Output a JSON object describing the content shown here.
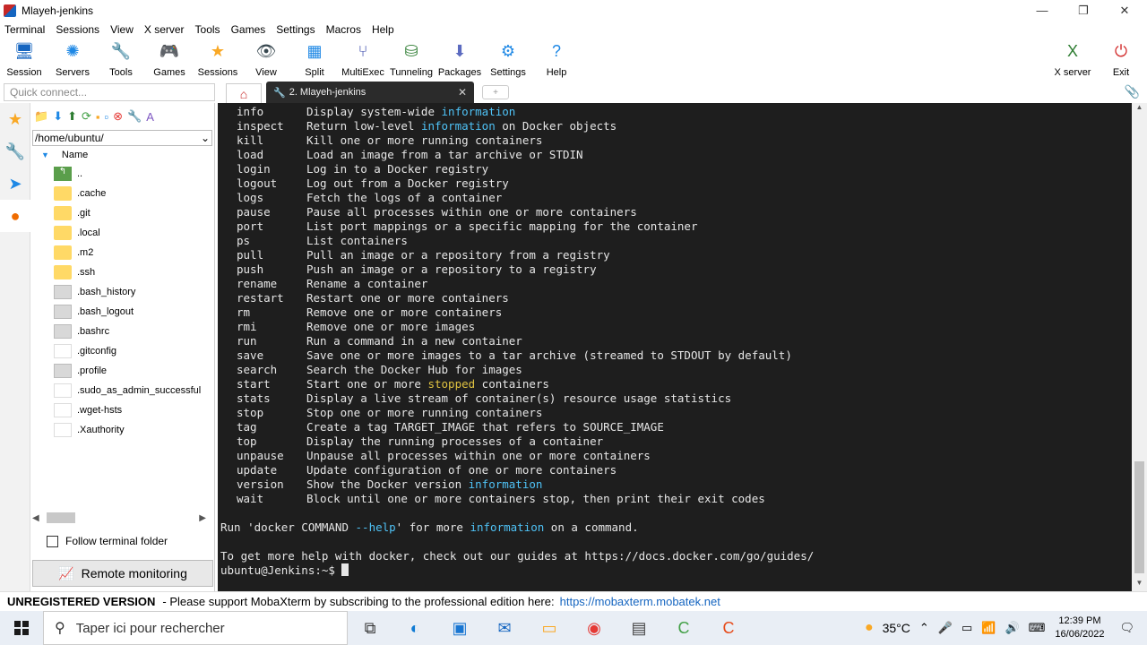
{
  "window": {
    "title": "Mlayeh-jenkins",
    "controls": {
      "minimize": "—",
      "maximize": "❐",
      "close": "✕"
    }
  },
  "menu": [
    "Terminal",
    "Sessions",
    "View",
    "X server",
    "Tools",
    "Games",
    "Settings",
    "Macros",
    "Help"
  ],
  "toolbar": [
    {
      "label": "Session",
      "icon": "🖥",
      "color": "#1565c0"
    },
    {
      "label": "Servers",
      "icon": "✺",
      "color": "#1e88e5"
    },
    {
      "label": "Tools",
      "icon": "🔧",
      "color": "#c62828"
    },
    {
      "label": "Games",
      "icon": "🎮",
      "color": "#555555"
    },
    {
      "label": "Sessions",
      "icon": "★",
      "color": "#f9a825"
    },
    {
      "label": "View",
      "icon": "👁",
      "color": "#37474f"
    },
    {
      "label": "Split",
      "icon": "▦",
      "color": "#1e88e5"
    },
    {
      "label": "MultiExec",
      "icon": "⑂",
      "color": "#3949ab"
    },
    {
      "label": "Tunneling",
      "icon": "⛁",
      "color": "#2e7d32"
    },
    {
      "label": "Packages",
      "icon": "⬇",
      "color": "#5c6bc0"
    },
    {
      "label": "Settings",
      "icon": "⚙",
      "color": "#1e88e5"
    },
    {
      "label": "Help",
      "icon": "?",
      "color": "#1e88e5"
    }
  ],
  "toolbar_right": [
    {
      "label": "X server",
      "icon": "X",
      "color": "#2e7d32"
    },
    {
      "label": "Exit",
      "icon": "⏻",
      "color": "#d32f2f"
    }
  ],
  "quick_connect": {
    "placeholder": "Quick connect..."
  },
  "tabs": {
    "active_label": "2. Mlayeh-jenkins",
    "close": "✕"
  },
  "file_panel": {
    "path": "/home/ubuntu/",
    "column": "Name",
    "items": [
      {
        "name": "..",
        "type": "up"
      },
      {
        "name": ".cache",
        "type": "folder"
      },
      {
        "name": ".git",
        "type": "folder"
      },
      {
        "name": ".local",
        "type": "folder"
      },
      {
        "name": ".m2",
        "type": "folder"
      },
      {
        "name": ".ssh",
        "type": "folder"
      },
      {
        "name": ".bash_history",
        "type": "file"
      },
      {
        "name": ".bash_logout",
        "type": "file"
      },
      {
        "name": ".bashrc",
        "type": "file"
      },
      {
        "name": ".gitconfig",
        "type": "doc"
      },
      {
        "name": ".profile",
        "type": "file"
      },
      {
        "name": ".sudo_as_admin_successful",
        "type": "doc"
      },
      {
        "name": ".wget-hsts",
        "type": "doc"
      },
      {
        "name": ".Xauthority",
        "type": "doc"
      }
    ],
    "follow_label": "Follow terminal folder",
    "remote_label": "Remote monitoring"
  },
  "terminal": {
    "commands": [
      {
        "cmd": "info",
        "desc": [
          "Display system-wide ",
          {
            "hl": "information"
          }
        ]
      },
      {
        "cmd": "inspect",
        "desc": [
          "Return low-level ",
          {
            "hl": "information"
          },
          " on Docker objects"
        ]
      },
      {
        "cmd": "kill",
        "desc": [
          "Kill one or more running containers"
        ]
      },
      {
        "cmd": "load",
        "desc": [
          "Load an image from a tar archive or STDIN"
        ]
      },
      {
        "cmd": "login",
        "desc": [
          "Log in to a Docker registry"
        ]
      },
      {
        "cmd": "logout",
        "desc": [
          "Log out from a Docker registry"
        ]
      },
      {
        "cmd": "logs",
        "desc": [
          "Fetch the logs of a container"
        ]
      },
      {
        "cmd": "pause",
        "desc": [
          "Pause all processes within one or more containers"
        ]
      },
      {
        "cmd": "port",
        "desc": [
          "List port mappings or a specific mapping for the container"
        ]
      },
      {
        "cmd": "ps",
        "desc": [
          "List containers"
        ]
      },
      {
        "cmd": "pull",
        "desc": [
          "Pull an image or a repository from a registry"
        ]
      },
      {
        "cmd": "push",
        "desc": [
          "Push an image or a repository to a registry"
        ]
      },
      {
        "cmd": "rename",
        "desc": [
          "Rename a container"
        ]
      },
      {
        "cmd": "restart",
        "desc": [
          "Restart one or more containers"
        ]
      },
      {
        "cmd": "rm",
        "desc": [
          "Remove one or more containers"
        ]
      },
      {
        "cmd": "rmi",
        "desc": [
          "Remove one or more images"
        ]
      },
      {
        "cmd": "run",
        "desc": [
          "Run a command in a new container"
        ]
      },
      {
        "cmd": "save",
        "desc": [
          "Save one or more images to a tar archive (streamed to STDOUT by default)"
        ]
      },
      {
        "cmd": "search",
        "desc": [
          "Search the Docker Hub for images"
        ]
      },
      {
        "cmd": "start",
        "desc": [
          "Start one or more ",
          {
            "yl": "stopped"
          },
          " containers"
        ]
      },
      {
        "cmd": "stats",
        "desc": [
          "Display a live stream of container(s) resource usage statistics"
        ]
      },
      {
        "cmd": "stop",
        "desc": [
          "Stop one or more running containers"
        ]
      },
      {
        "cmd": "tag",
        "desc": [
          "Create a tag TARGET_IMAGE that refers to SOURCE_IMAGE"
        ]
      },
      {
        "cmd": "top",
        "desc": [
          "Display the running processes of a container"
        ]
      },
      {
        "cmd": "unpause",
        "desc": [
          "Unpause all processes within one or more containers"
        ]
      },
      {
        "cmd": "update",
        "desc": [
          "Update configuration of one or more containers"
        ]
      },
      {
        "cmd": "version",
        "desc": [
          "Show the Docker version ",
          {
            "hl": "information"
          }
        ]
      },
      {
        "cmd": "wait",
        "desc": [
          "Block until one or more containers stop, then print their exit codes"
        ]
      }
    ],
    "help_line": [
      "Run 'docker COMMAND ",
      {
        "hl": "--help"
      },
      "' for more ",
      {
        "hl": "information"
      },
      " on a command."
    ],
    "guides_line": "To get more help with docker, check out our guides at https://docs.docker.com/go/guides/",
    "prompt": "ubuntu@Jenkins:~$ "
  },
  "status_bar": {
    "unregistered": "UNREGISTERED VERSION",
    "message": "-  Please support MobaXterm by subscribing to the professional edition here:",
    "link": "https://mobaxterm.mobatek.net"
  },
  "taskbar": {
    "search_placeholder": "Taper ici pour rechercher",
    "weather": "35°C",
    "time": "12:39 PM",
    "date": "16/06/2022",
    "apps": [
      {
        "name": "task-view-icon",
        "glyph": "⧉",
        "color": "#333333"
      },
      {
        "name": "edge-icon",
        "glyph": "◐",
        "color": "#0f7ad3"
      },
      {
        "name": "store-icon",
        "glyph": "▣",
        "color": "#1976d2"
      },
      {
        "name": "mail-icon",
        "glyph": "✉",
        "color": "#1565c0"
      },
      {
        "name": "explorer-icon",
        "glyph": "▭",
        "color": "#f9a825"
      },
      {
        "name": "chrome-icon",
        "glyph": "◉",
        "color": "#e53935"
      },
      {
        "name": "mobaxterm-icon",
        "glyph": "▤",
        "color": "#424242"
      },
      {
        "name": "camtasia-icon",
        "glyph": "C",
        "color": "#43a047"
      },
      {
        "name": "recorder-icon",
        "glyph": "C",
        "color": "#e64a19"
      }
    ]
  }
}
